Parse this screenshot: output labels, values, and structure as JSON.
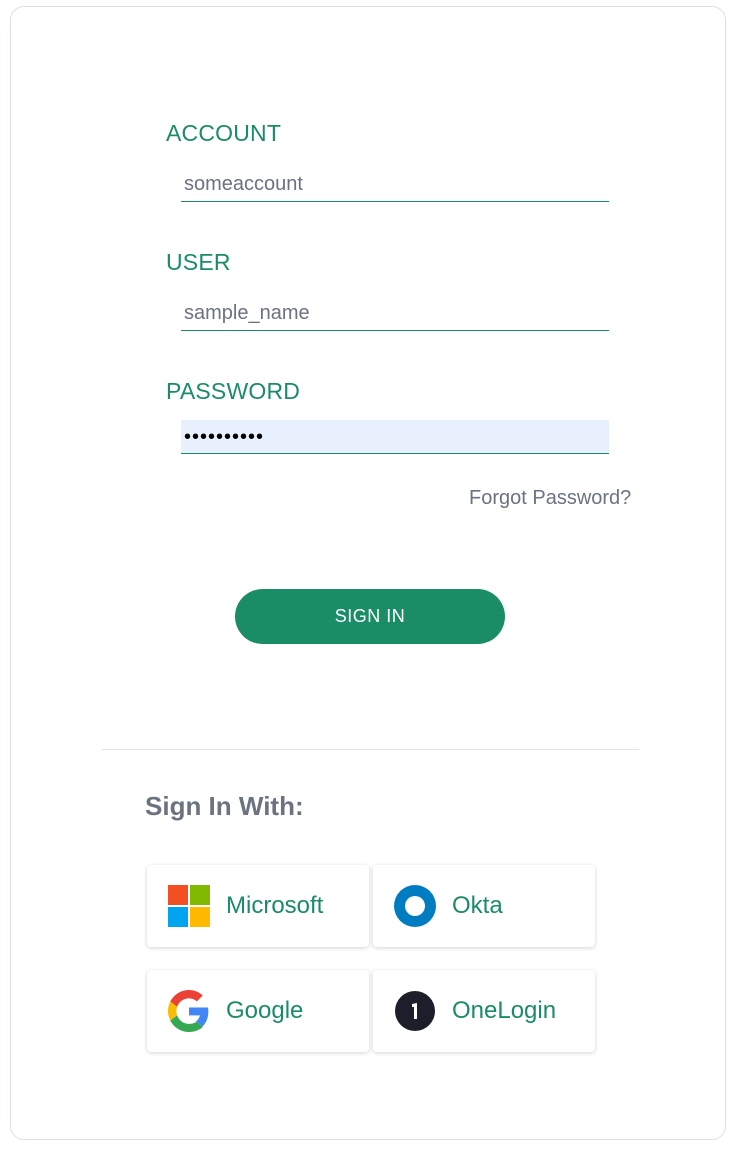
{
  "form": {
    "account": {
      "label": "ACCOUNT",
      "placeholder": "someaccount",
      "value": ""
    },
    "user": {
      "label": "USER",
      "placeholder": "sample_name",
      "value": ""
    },
    "password": {
      "label": "PASSWORD",
      "value": "••••••••••"
    },
    "forgot_label": "Forgot Password?",
    "signin_label": "SIGN IN"
  },
  "sso": {
    "heading": "Sign In With:",
    "providers": [
      {
        "label": "Microsoft",
        "icon": "microsoft-icon"
      },
      {
        "label": "Okta",
        "icon": "okta-icon"
      },
      {
        "label": "Google",
        "icon": "google-icon"
      },
      {
        "label": "OneLogin",
        "icon": "onelogin-icon"
      }
    ]
  },
  "colors": {
    "accent": "#1a8c66",
    "muted_text": "#6b7280",
    "password_bg": "#e8f0fe"
  }
}
